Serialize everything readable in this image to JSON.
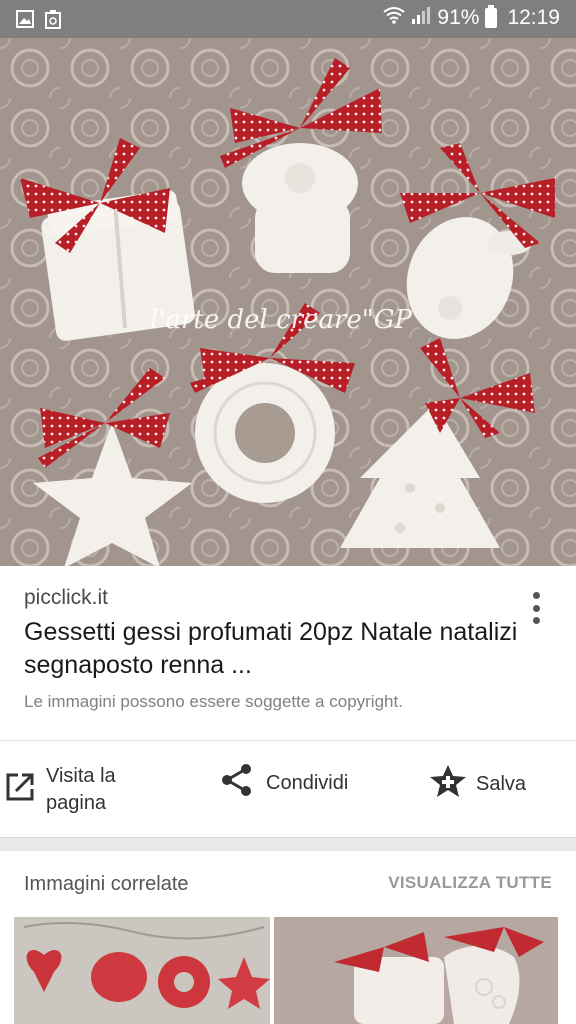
{
  "status_bar": {
    "battery": "91%",
    "time": "12:19"
  },
  "image": {
    "watermark": "l'arte del creare\"GP",
    "icon": "ornaments-photo"
  },
  "result": {
    "source": "picclick.it",
    "title": "Gessetti gessi profumati 20pz Natale natalizi segnaposto renna ...",
    "copyright": "Le immagini possono essere soggette a copyright."
  },
  "actions": {
    "visit": "Visita la pagina",
    "share": "Condividi",
    "save": "Salva"
  },
  "related": {
    "title": "Immagini correlate",
    "view_all": "VISUALIZZA TUTTE"
  },
  "colors": {
    "status_bar": "#7f7f7f",
    "ribbon": "#b81e26",
    "plaster": "#f3f0ec",
    "background_lace": "#a2958d"
  }
}
